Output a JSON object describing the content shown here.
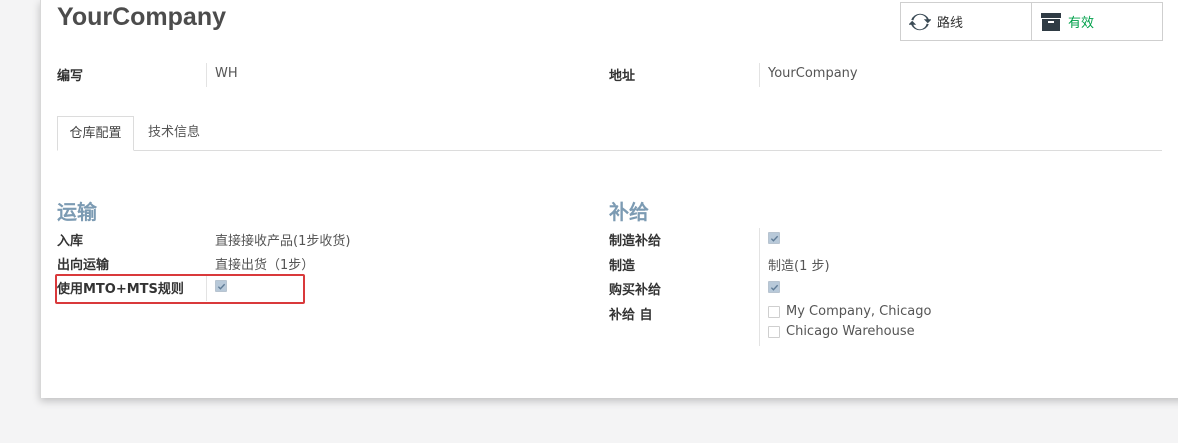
{
  "record": {
    "title": "YourCompany"
  },
  "smart_buttons": {
    "routes_label": "路线",
    "active_label": "有效"
  },
  "header_fields": {
    "short_name_label": "编写",
    "short_name_value": "WH",
    "address_label": "地址",
    "address_value": "YourCompany"
  },
  "tabs": [
    {
      "label": "仓库配置",
      "active": true
    },
    {
      "label": "技术信息",
      "active": false
    }
  ],
  "shipments": {
    "title": "运输",
    "incoming_label": "入库",
    "incoming_value": "直接接收产品(1步收货)",
    "outgoing_label": "出向运输",
    "outgoing_value": "直接出货（1步）",
    "mto_label": "使用MTO+MTS规则",
    "mto_checked": true
  },
  "resupply": {
    "title": "补给",
    "manufacture_label": "制造补给",
    "manufacture_checked": true,
    "manufacture_steps_label": "制造",
    "manufacture_steps_value": "制造(1 步)",
    "buy_label": "购买补给",
    "buy_checked": true,
    "resupply_from_label": "补给 自",
    "resupply_from": [
      {
        "label": "My Company, Chicago",
        "checked": false
      },
      {
        "label": "Chicago Warehouse",
        "checked": false
      }
    ]
  },
  "colors": {
    "section_title": "#7c9bb3",
    "active_status": "#00a04a",
    "highlight": "#d9393b"
  }
}
